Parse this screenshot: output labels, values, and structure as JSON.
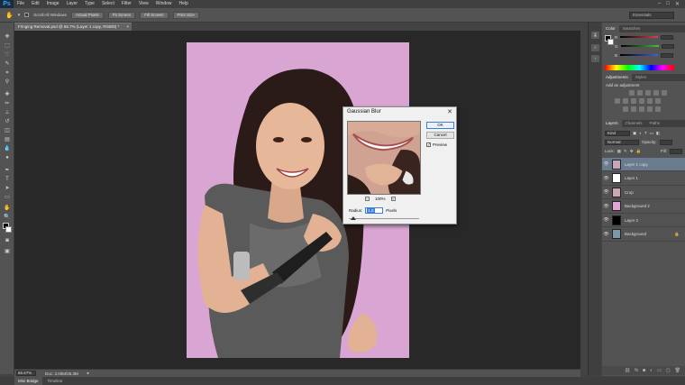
{
  "app": {
    "logo": "Ps",
    "menu": [
      "File",
      "Edit",
      "Image",
      "Layer",
      "Type",
      "Select",
      "Filter",
      "View",
      "Window",
      "Help"
    ],
    "window_controls": [
      "–",
      "□",
      "✕"
    ]
  },
  "options_bar": {
    "scroll_all_label": "Scroll All Windows",
    "buttons": [
      "Actual Pixels",
      "Fit Screen",
      "Fill Screen",
      "Print Size"
    ],
    "workspace": "Essentials"
  },
  "document": {
    "tab_title": "Fringing Removal.psd @ 66.7% (Layer 1 copy, RGB/8) *",
    "tab_close": "×"
  },
  "status": {
    "zoom": "66.67%",
    "doc_size": "Doc: 3.00M/25.3M"
  },
  "bottom_tabs": [
    "Mini Bridge",
    "Timeline"
  ],
  "panels": {
    "color_tabs": [
      "Color",
      "Swatches"
    ],
    "color_channels": [
      {
        "label": "R",
        "color": "#e04040"
      },
      {
        "label": "G",
        "color": "#40c040"
      },
      {
        "label": "B",
        "color": "#4060e0"
      }
    ],
    "adjust_tabs": [
      "Adjustments",
      "Styles"
    ],
    "adjust_title": "Add an adjustment",
    "layers_tabs": [
      "Layers",
      "Channels",
      "Paths"
    ],
    "kind_label": "Kind",
    "blend_mode": "Normal",
    "opacity_label": "Opacity:",
    "lock_label": "Lock:",
    "fill_label": "Fill:",
    "layers": [
      {
        "name": "Layer 1 copy",
        "selected": true,
        "thumb": "#c9a6b6",
        "locked": false
      },
      {
        "name": "Layer 1",
        "selected": false,
        "thumb": "#ffffff",
        "locked": false
      },
      {
        "name": "Crop",
        "selected": false,
        "thumb": "#c9a6b6",
        "locked": false
      },
      {
        "name": "Background 2",
        "selected": false,
        "thumb": "#e3a5d8",
        "locked": false
      },
      {
        "name": "Layer 2",
        "selected": false,
        "thumb": "#000000",
        "locked": false
      },
      {
        "name": "Background",
        "selected": false,
        "thumb": "#7a9aaa",
        "locked": true
      }
    ]
  },
  "dialog": {
    "title": "Gaussian Blur",
    "close": "✕",
    "ok": "OK",
    "cancel": "Cancel",
    "preview_label": "Preview",
    "preview_checked": true,
    "zoom_out": "−",
    "zoom_in": "+",
    "zoom": "100%",
    "radius_label": "Radius:",
    "radius_value": "1.0",
    "radius_unit": "Pixels"
  },
  "colors": {
    "canvas_bg": "#d9a6d3",
    "selection": "#6a7a8f"
  }
}
